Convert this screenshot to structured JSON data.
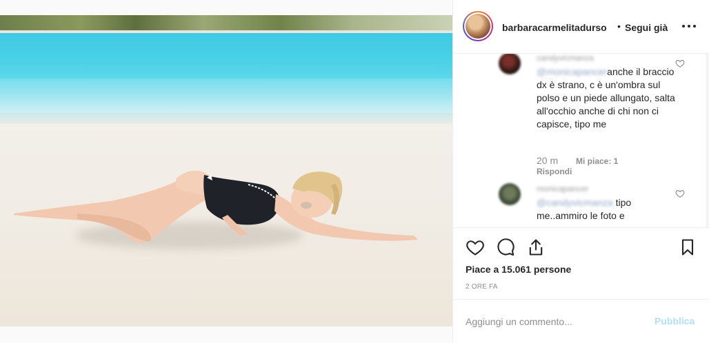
{
  "post": {
    "username": "barbaracarmelitadurso",
    "separator": "•",
    "follow_status": "Segui già",
    "likes_text": "Piace a 15.061 persone",
    "time_ago": "2 ORE FA"
  },
  "comments": [
    {
      "username": "candyvicmanza",
      "mention": "@monicapancer",
      "text": "anche il braccio dx è strano, c è un'ombra sul polso e un piede allungato, salta all'occhio anche di chi non ci capisce, tipo me",
      "time": "20 m",
      "likes": "Mi piace: 1",
      "reply": "Rispondi"
    },
    {
      "username": "monicapancer",
      "mention": "@candyvicmanza",
      "text": "tipo me..ammiro le foto e"
    }
  ],
  "comment_box": {
    "placeholder": "Aggiungi un commento...",
    "publish_label": "Pubblica"
  },
  "icons": {
    "like": "heart-icon",
    "comment": "comment-icon",
    "share": "share-icon",
    "save": "bookmark-icon",
    "more": "more-options-icon"
  },
  "colors": {
    "publish_disabled": "#b2dffc",
    "pool": "#48d0e6",
    "secondary_text": "#8e8e8e"
  }
}
